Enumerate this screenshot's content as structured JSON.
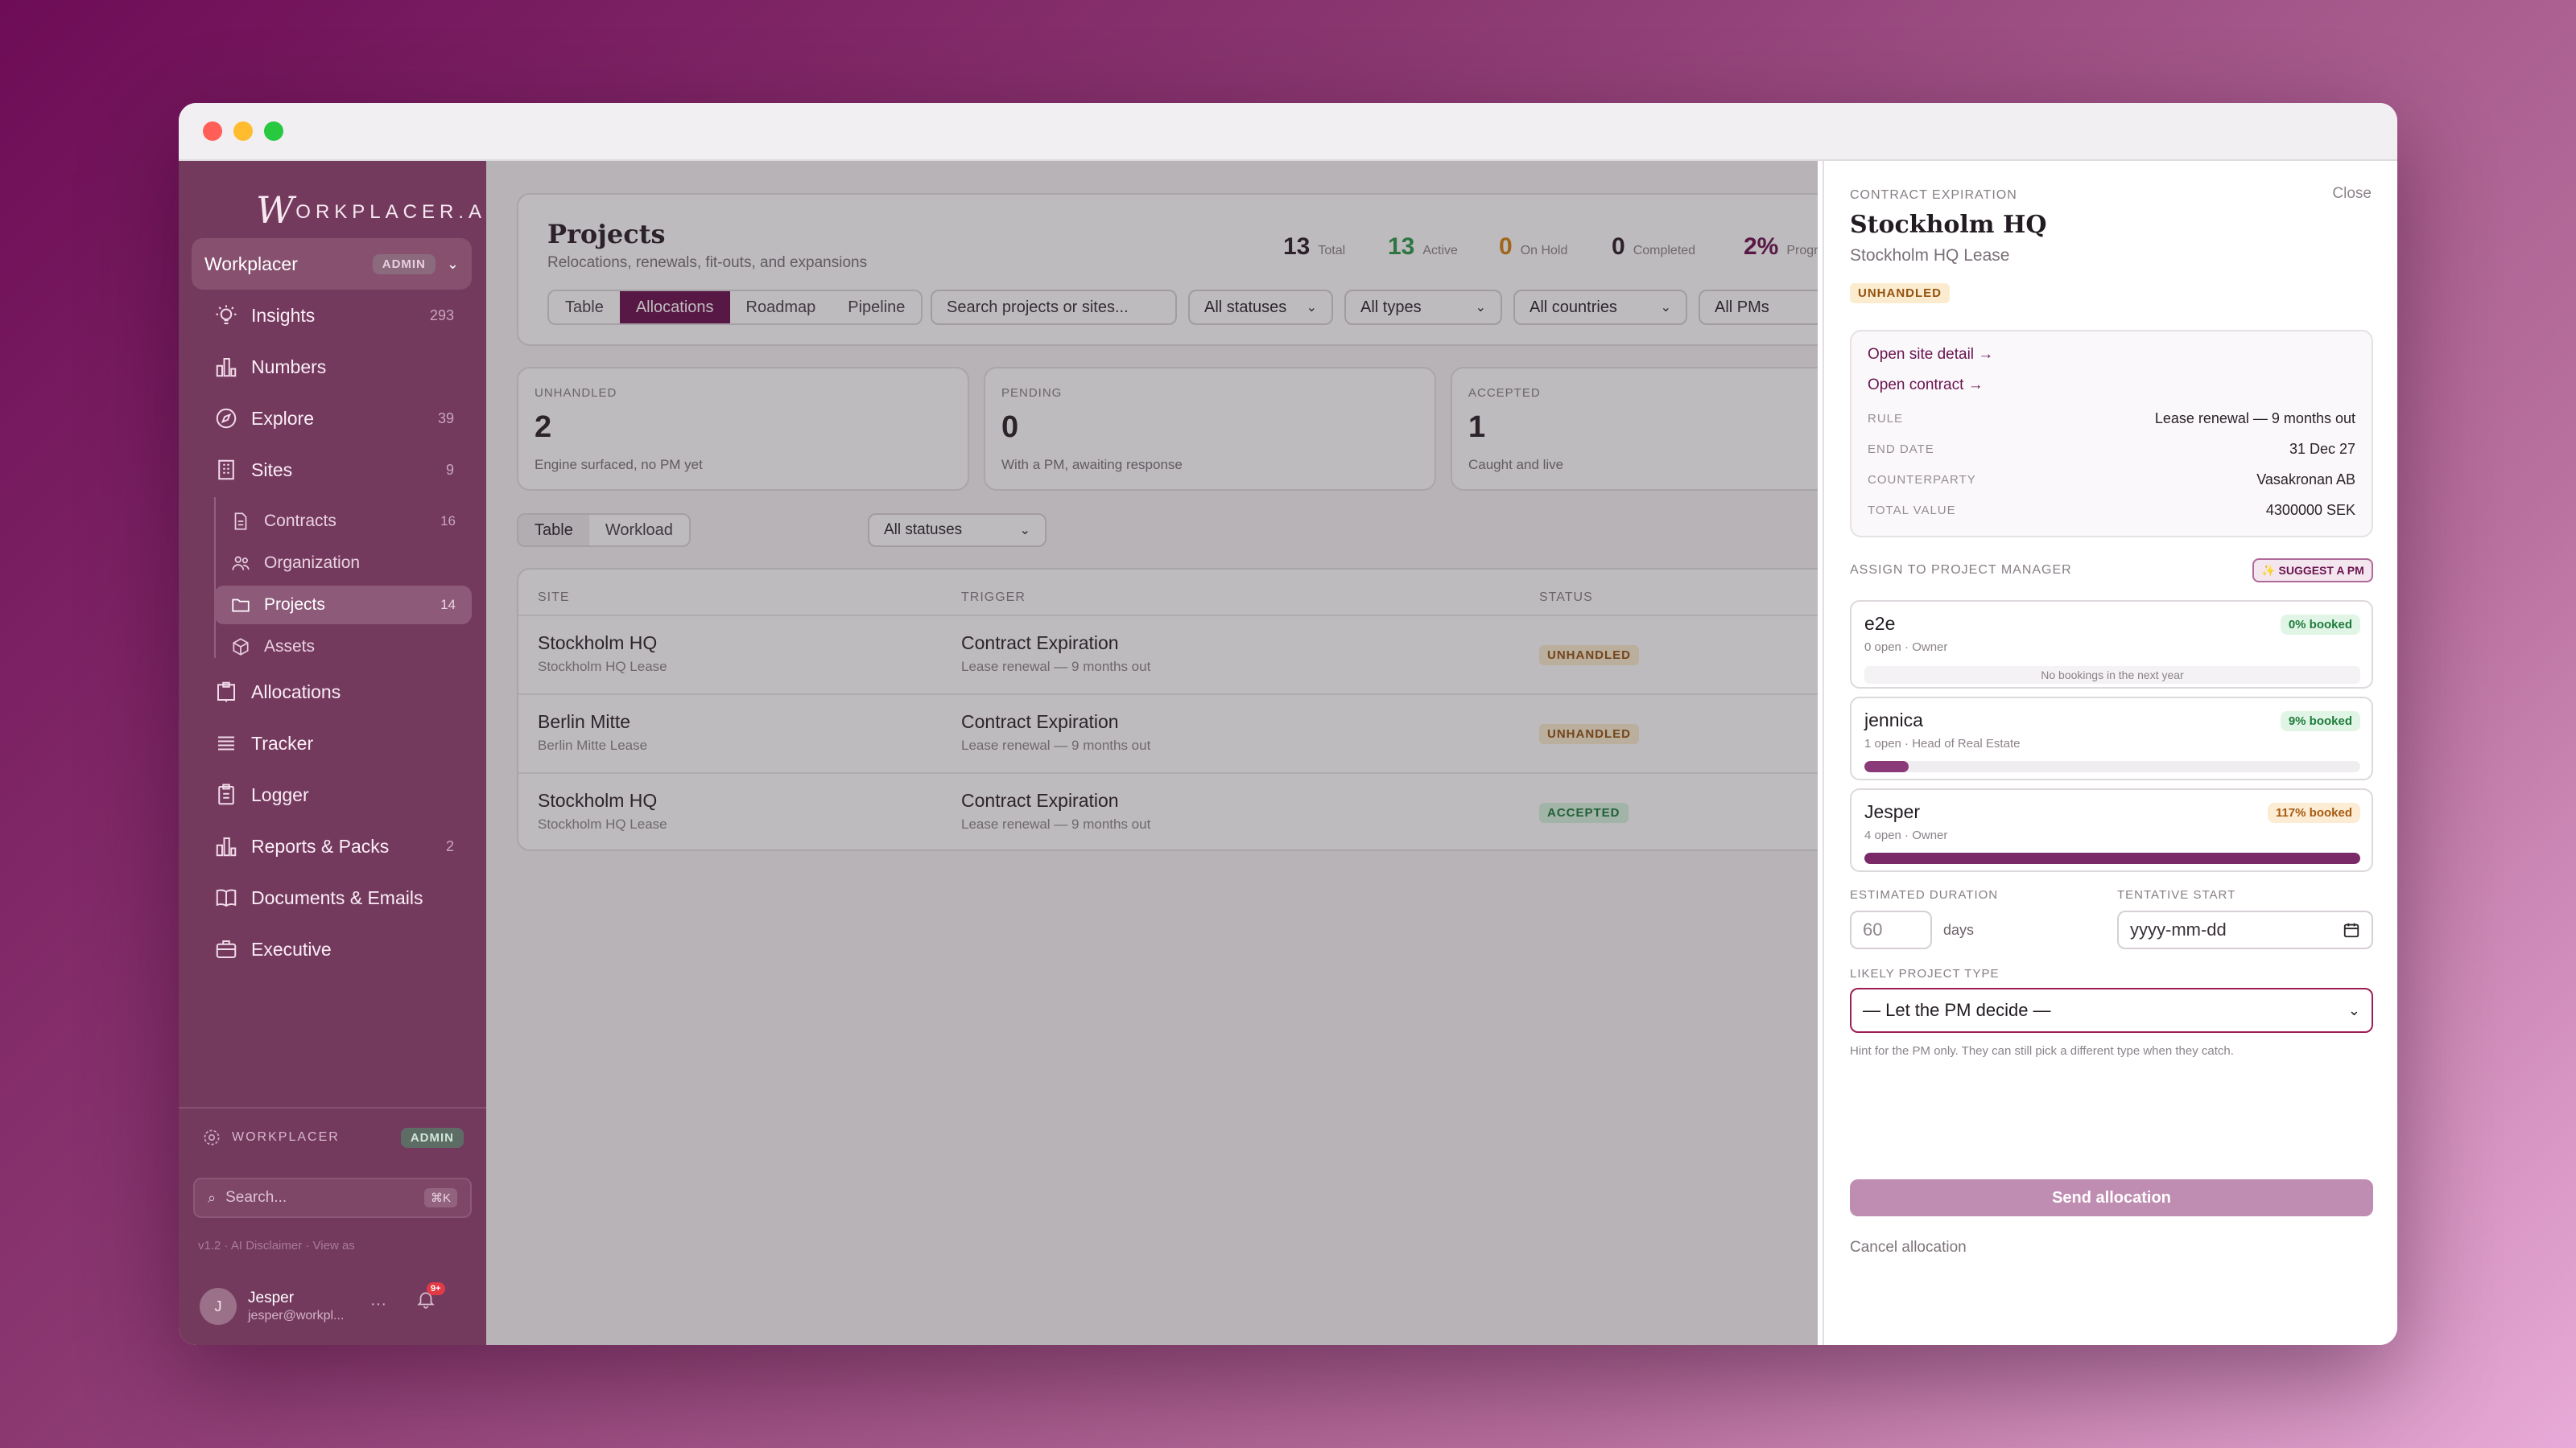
{
  "window": {
    "dot_colors": [
      "#ff5f57",
      "#febc2e",
      "#28c840"
    ]
  },
  "sidebar": {
    "logo": "ORKPLACER.AI",
    "logo_mark": "W",
    "workspace": {
      "name": "Workplacer",
      "badge": "ADMIN"
    },
    "items": [
      {
        "label": "Insights",
        "count": "293",
        "icon": "lightbulb-icon"
      },
      {
        "label": "Numbers",
        "count": "",
        "icon": "bar-chart-icon"
      },
      {
        "label": "Explore",
        "count": "39",
        "icon": "compass-icon"
      },
      {
        "label": "Sites",
        "count": "9",
        "icon": "building-icon"
      },
      {
        "label": "Allocations",
        "count": "",
        "icon": "clipboard-icon"
      },
      {
        "label": "Tracker",
        "count": "",
        "icon": "list-icon"
      },
      {
        "label": "Logger",
        "count": "",
        "icon": "clipboard-list-icon"
      },
      {
        "label": "Reports & Packs",
        "count": "2",
        "icon": "bar-chart-icon"
      },
      {
        "label": "Documents & Emails",
        "count": "",
        "icon": "book-icon"
      },
      {
        "label": "Executive",
        "count": "",
        "icon": "briefcase-icon"
      }
    ],
    "subitems": [
      {
        "label": "Contracts",
        "count": "16",
        "icon": "document-icon"
      },
      {
        "label": "Organization",
        "count": "",
        "icon": "people-icon"
      },
      {
        "label": "Projects",
        "count": "14",
        "icon": "folder-icon"
      },
      {
        "label": "Assets",
        "count": "",
        "icon": "cube-icon"
      }
    ],
    "footer_ws": {
      "label": "WORKPLACER",
      "badge": "ADMIN"
    },
    "search": {
      "placeholder": "Search...",
      "shortcut": "⌘K"
    },
    "meta": "v1.2  ·  AI Disclaimer  ·  View as",
    "user": {
      "initial": "J",
      "name": "Jesper",
      "email": "jesper@workpl...",
      "more": "···",
      "notif": "9+"
    }
  },
  "main": {
    "title": "Projects",
    "subtitle": "Relocations, renewals, fit-outs, and expansions",
    "stats": [
      {
        "value": "13",
        "label": "Total",
        "color": "#2b1d28"
      },
      {
        "value": "13",
        "label": "Active",
        "color": "#2c9a4a"
      },
      {
        "value": "0",
        "label": "On Hold",
        "color": "#d58312"
      },
      {
        "value": "0",
        "label": "Completed",
        "color": "#2b1d28"
      },
      {
        "value": "2%",
        "label": "Progre",
        "color": "#6b0f4f"
      }
    ],
    "tabs": [
      "Table",
      "Allocations",
      "Roadmap",
      "Pipeline"
    ],
    "search_placeholder": "Search projects or sites...",
    "filters": [
      "All statuses",
      "All types",
      "All countries",
      "All PMs"
    ],
    "summary": [
      {
        "label": "UNHANDLED",
        "value": "2",
        "desc": "Engine surfaced, no PM yet"
      },
      {
        "label": "PENDING",
        "value": "0",
        "desc": "With a PM, awaiting response"
      },
      {
        "label": "ACCEPTED",
        "value": "1",
        "desc": "Caught and live"
      }
    ],
    "view_tabs": [
      "Table",
      "Workload"
    ],
    "status_filter": "All statuses",
    "table": {
      "headers": [
        "SITE",
        "TRIGGER",
        "STATUS"
      ],
      "rows": [
        {
          "site": "Stockholm HQ",
          "lease": "Stockholm HQ Lease",
          "trigger": "Contract Expiration",
          "rule": "Lease renewal — 9 months out",
          "status": "UNHANDLED"
        },
        {
          "site": "Berlin Mitte",
          "lease": "Berlin Mitte Lease",
          "trigger": "Contract Expiration",
          "rule": "Lease renewal — 9 months out",
          "status": "UNHANDLED"
        },
        {
          "site": "Stockholm HQ",
          "lease": "Stockholm HQ Lease",
          "trigger": "Contract Expiration",
          "rule": "Lease renewal — 9 months out",
          "status": "ACCEPTED"
        }
      ]
    }
  },
  "panel": {
    "eyebrow": "CONTRACT EXPIRATION",
    "close": "Close",
    "title": "Stockholm HQ",
    "subtitle": "Stockholm HQ Lease",
    "status": "UNHANDLED",
    "links": [
      "Open site detail →",
      "Open contract →"
    ],
    "details": [
      {
        "k": "RULE",
        "v": "Lease renewal — 9 months out"
      },
      {
        "k": "END DATE",
        "v": "31 Dec 27"
      },
      {
        "k": "COUNTERPARTY",
        "v": "Vasakronan AB"
      },
      {
        "k": "TOTAL VALUE",
        "v": "4300000 SEK"
      }
    ],
    "assign_label": "ASSIGN TO PROJECT MANAGER",
    "suggest_label": "✨ SUGGEST A PM",
    "pms": [
      {
        "name": "e2e",
        "sub": "0 open · Owner",
        "booked": "0% booked",
        "booked_pct": 0,
        "note": "No bookings in the next year",
        "tone": "green"
      },
      {
        "name": "jennica",
        "sub": "1 open · Head of Real Estate",
        "booked": "9% booked",
        "booked_pct": 9,
        "note": "",
        "tone": "green"
      },
      {
        "name": "Jesper",
        "sub": "4 open · Owner",
        "booked": "117% booked",
        "booked_pct": 100,
        "note": "",
        "tone": "orange"
      }
    ],
    "duration_label": "ESTIMATED DURATION",
    "duration_value": "60",
    "duration_unit": "days",
    "start_label": "TENTATIVE START",
    "start_placeholder": "yyyy-mm-dd",
    "type_label": "LIKELY PROJECT TYPE",
    "type_value": "— Let the PM decide —",
    "hint": "Hint for the PM only. They can still pick a different type when they catch.",
    "send": "Send allocation",
    "cancel": "Cancel allocation"
  }
}
